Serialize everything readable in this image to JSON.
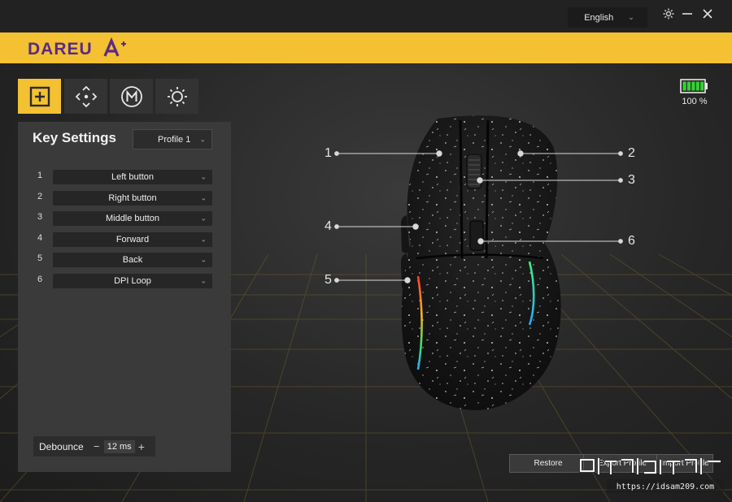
{
  "titlebar": {
    "language": "English",
    "icons": [
      "settings-icon",
      "minimize-icon",
      "close-icon"
    ]
  },
  "brand": {
    "logo_text": "DAREU",
    "logo_mark": "A+"
  },
  "tabs": [
    {
      "name": "key-settings",
      "icon": "plus-box-icon",
      "active": true
    },
    {
      "name": "dpi",
      "icon": "move-arrows-icon",
      "active": false
    },
    {
      "name": "macro",
      "icon": "macro-m-icon",
      "active": false
    },
    {
      "name": "lighting",
      "icon": "sun-icon",
      "active": false
    }
  ],
  "battery": {
    "level_percent": 100,
    "label": "100 %"
  },
  "panel": {
    "title": "Key Settings",
    "profile": "Profile 1",
    "keys": [
      {
        "num": "1",
        "action": "Left button"
      },
      {
        "num": "2",
        "action": "Right button"
      },
      {
        "num": "3",
        "action": "Middle button"
      },
      {
        "num": "4",
        "action": "Forward"
      },
      {
        "num": "5",
        "action": "Back"
      },
      {
        "num": "6",
        "action": "DPI Loop"
      }
    ],
    "debounce": {
      "label": "Debounce",
      "value": "12 ms",
      "minus": "−",
      "plus": "+"
    }
  },
  "callouts": [
    "1",
    "2",
    "3",
    "4",
    "5",
    "6"
  ],
  "buttons": {
    "restore": "Restore",
    "export": "Export Profile",
    "import": "Import Profile"
  },
  "watermark": {
    "text": "https://idsam209.com"
  },
  "colors": {
    "accent": "#f3c131",
    "battery": "#35d134",
    "logo_purple": "#5a2a86"
  }
}
